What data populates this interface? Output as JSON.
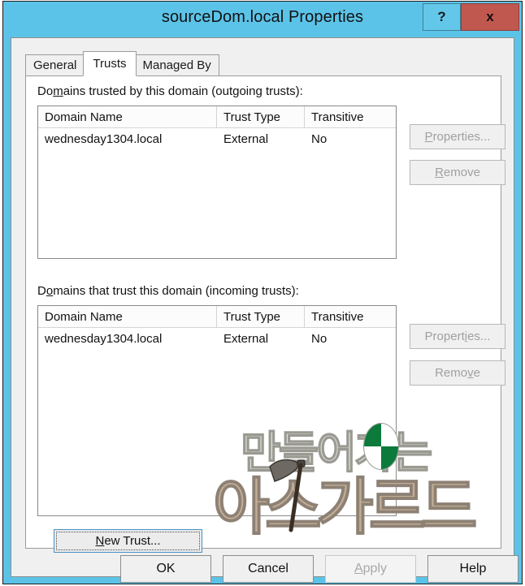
{
  "window": {
    "title": "sourceDom.local Properties",
    "help_button": "?",
    "close_button": "x",
    "titlebar_color": "#5cc3e8",
    "close_color": "#c1584f"
  },
  "tabs": [
    {
      "label": "General",
      "active": false
    },
    {
      "label": "Trusts",
      "active": true
    },
    {
      "label": "Managed By",
      "active": false
    }
  ],
  "outgoing": {
    "label_pre": "Do",
    "label_accel": "m",
    "label_post": "ains trusted by this domain (outgoing trusts):",
    "columns": [
      "Domain Name",
      "Trust Type",
      "Transitive"
    ],
    "rows": [
      {
        "domain": "wednesday1304.local",
        "trust_type": "External",
        "transitive": "No"
      }
    ],
    "properties_pre": "",
    "properties_accel": "P",
    "properties_post": "roperties...",
    "remove_pre": "",
    "remove_accel": "R",
    "remove_post": "emove",
    "properties_enabled": false,
    "remove_enabled": false
  },
  "incoming": {
    "label_pre": "D",
    "label_accel": "o",
    "label_post": "mains that trust this domain (incoming trusts):",
    "columns": [
      "Domain Name",
      "Trust Type",
      "Transitive"
    ],
    "rows": [
      {
        "domain": "wednesday1304.local",
        "trust_type": "External",
        "transitive": "No"
      }
    ],
    "properties_pre": "Propert",
    "properties_accel": "i",
    "properties_post": "es...",
    "remove_pre": "Remo",
    "remove_accel": "v",
    "remove_post": "e",
    "properties_enabled": false,
    "remove_enabled": false
  },
  "new_trust": {
    "pre": "",
    "accel": "N",
    "post": "ew Trust...",
    "focused": true
  },
  "dialog_buttons": {
    "ok": "OK",
    "cancel": "Cancel",
    "apply_pre": "",
    "apply_accel": "A",
    "apply_post": "pply",
    "apply_enabled": false,
    "help": "Help"
  },
  "watermark": {
    "line1": "만들어가는",
    "line2": "아스가르드",
    "line1_color": "#e2e2de",
    "line2_color": "#c3ad93",
    "badge_color": "#0b7a3b"
  }
}
